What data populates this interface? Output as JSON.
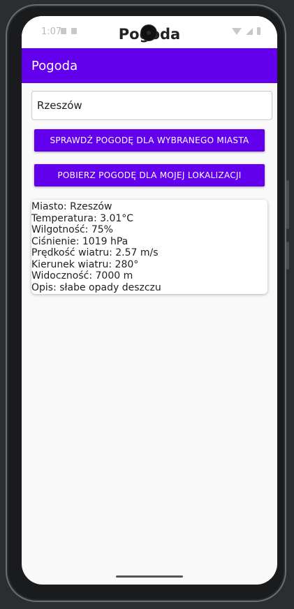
{
  "status_bar": {
    "time": "1:07"
  },
  "window": {
    "title": "Pogoda"
  },
  "app_bar": {
    "title": "Pogoda"
  },
  "city_input": {
    "value": "Rzeszów"
  },
  "buttons": {
    "check_city": "SPRAWDŹ POGODĘ DLA WYBRANEGO MIASTA",
    "my_location": "POBIERZ POGODĘ DLA MOJEJ LOKALIZACJI"
  },
  "weather": {
    "lines": [
      "Miasto: Rzeszów",
      "Temperatura: 3.01°C",
      "Wilgotność: 75%",
      "Ciśnienie: 1019 hPa",
      "Prędkość wiatru: 2.57 m/s",
      "Kierunek wiatru: 280°",
      "Widoczność: 7000 m",
      "Opis: słabe opady deszczu"
    ]
  },
  "colors": {
    "primary": "#6200ee",
    "background": "#f9f9f9"
  }
}
